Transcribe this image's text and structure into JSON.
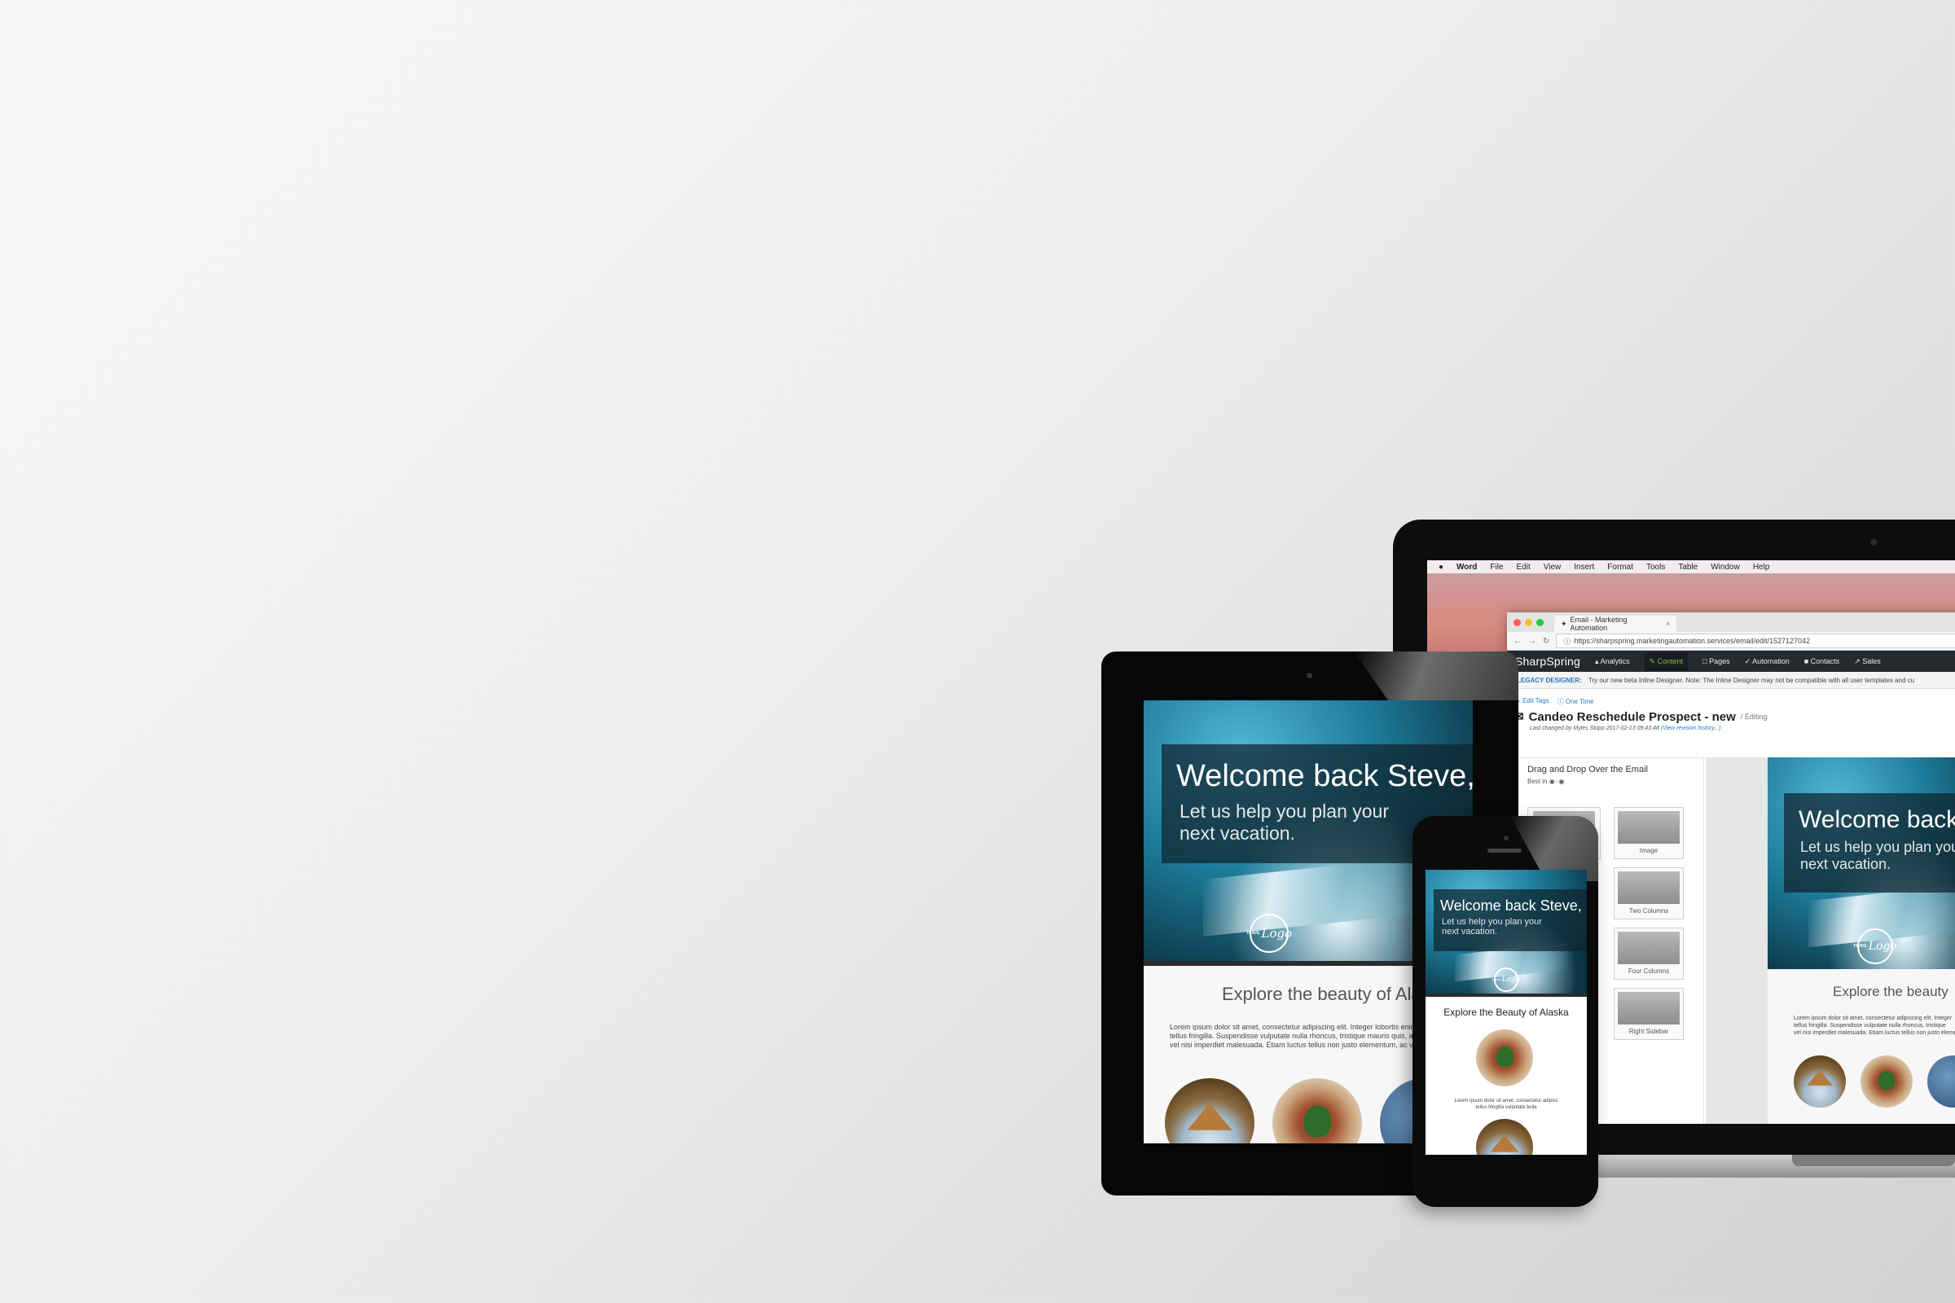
{
  "mac_menubar": {
    "app": "Word",
    "items": [
      "File",
      "Edit",
      "View",
      "Insert",
      "Format",
      "Tools",
      "Table",
      "Window",
      "Help"
    ]
  },
  "browser": {
    "tab_title": "Email - Marketing Automation",
    "url": "https://sharpspring.marketingautomation.services/email/edit/1527127042"
  },
  "app_nav": {
    "logo": "SharpSpring",
    "items": [
      "Analytics",
      "Content",
      "Pages",
      "Automation",
      "Contacts",
      "Sales"
    ],
    "active": "Content"
  },
  "legacy_banner": {
    "label": "LEGACY DESIGNER:",
    "text": "Try our new beta Inline Designer. Note: The Inline Designer may not be compatible with all user templates and cu"
  },
  "email_meta": {
    "edit_tags": "Edit Tags",
    "one_time": "One Time",
    "title": "Candeo Reschedule Prospect - new",
    "status": "/ Editing",
    "last_changed": "Last changed by Myles Stupp 2017-02-13 09:43:48",
    "history_link": "(View revision history...)"
  },
  "dnd_panel": {
    "title": "Drag and Drop Over the Email",
    "subtitle": "Best in",
    "blocks": [
      "Image",
      "Two Columns",
      "Four Columns",
      "Right Sidebar"
    ]
  },
  "email": {
    "hero_title": "Welcome back Steve,",
    "hero_subtitle_line1": "Let us help you plan your",
    "hero_subtitle_line2": "next vacation.",
    "logo_small": "TRAVE",
    "logo_script": "Logo",
    "section_heading_tablet": "Explore the beauty of Alaska",
    "section_heading_laptop": "Explore the beauty",
    "section_heading_phone": "Explore the Beauty of Alaska",
    "body_tablet_line1": "Lorem ipsum dolor sit amet, consectetur adipiscing elit. Integer lobortis enim a",
    "body_tablet_line2": "tellus fringilla. Suspendisse vulputate nulla rhoncus, tristique mauris quis, aliquam",
    "body_tablet_line3": "vel nisi imperdiet malesuada. Etiam luctus tellus non justo elementum, ac varius",
    "body_laptop_line1": "Lorem ipsum dolor sit amet, consectetur adipiscing elit. Integer",
    "body_laptop_line2": "tellus fringilla. Suspendisse vulputate nulla rhoncus, tristique",
    "body_laptop_line3": "vel nisi imperdiet malesuada. Etiam luctus tellus non justo eleme",
    "body_phone_line1": "Lorem ipsum dolor sit amet, consectetur adipisc",
    "body_phone_line2": "tellus fringilla vulputate bulla"
  },
  "colors": {
    "app_nav_bg": "#262a2e",
    "active_nav": "#7ac142",
    "link_blue": "#2a7abf",
    "mac_red": "#ff5f57",
    "mac_yellow": "#febc2e",
    "mac_green": "#28c840"
  }
}
